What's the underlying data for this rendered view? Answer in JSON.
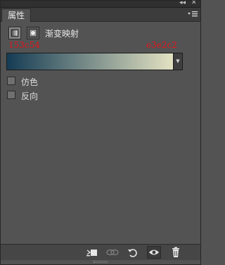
{
  "window": {
    "collapse_icon": "double-chevron-left-icon",
    "close_icon": "close-icon"
  },
  "panel": {
    "tab_label": "属性",
    "menu_icon": "panel-menu-icon"
  },
  "adjustment": {
    "title": "渐变映射",
    "layer_icon": "gradient-map-icon",
    "mask_icon": "layer-mask-icon"
  },
  "annotations": {
    "left_hex": "153c54",
    "right_hex": "e3e2c2"
  },
  "gradient": {
    "start_color": "#153c54",
    "end_color": "#e3e2c2",
    "dropdown_icon": "chevron-down-icon"
  },
  "options": [
    {
      "label": "仿色",
      "checked": false
    },
    {
      "label": "反向",
      "checked": false
    }
  ],
  "toolbar": {
    "clip_icon": "clip-to-layer-icon",
    "view_previous_icon": "view-previous-icon",
    "reset_icon": "reset-icon",
    "visibility_icon": "eye-icon",
    "delete_icon": "trash-icon"
  },
  "colors": {
    "panel_bg": "#535353",
    "annotation_red": "#e0141b"
  }
}
